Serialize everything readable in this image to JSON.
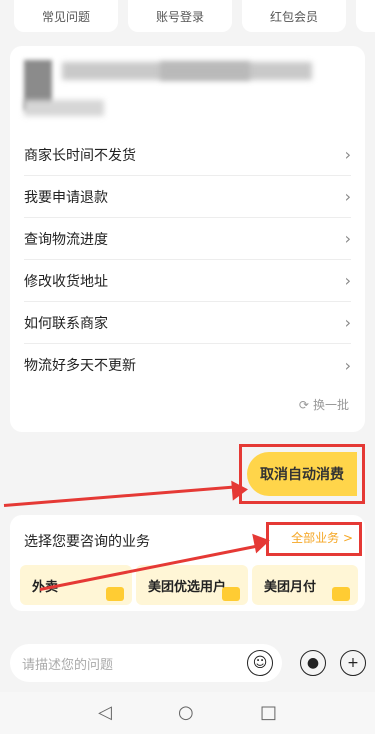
{
  "top_chips": [
    "常见问题",
    "账号登录",
    "红包会员"
  ],
  "questions": [
    "商家长时间不发货",
    "我要申请退款",
    "查询物流进度",
    "修改收货地址",
    "如何联系商家",
    "物流好多天不更新"
  ],
  "refresh_label": "换一批",
  "cancel_button_label": "取消自动消费",
  "business": {
    "title": "选择您要咨询的业务",
    "all_label": "全部业务 >",
    "cards": [
      "外卖",
      "美团优选用户",
      "美团月付"
    ]
  },
  "input": {
    "placeholder": "请描述您的问题"
  },
  "colors": {
    "accent_yellow": "#ffd54a",
    "annotation_red": "#e53935"
  },
  "icons": {
    "chevron": "chevron-right-icon",
    "refresh": "refresh-icon",
    "emoji": "smile-icon",
    "voice": "microphone-icon",
    "add": "plus-icon",
    "back": "nav-back-icon",
    "home": "nav-home-icon",
    "recents": "nav-recents-icon"
  }
}
